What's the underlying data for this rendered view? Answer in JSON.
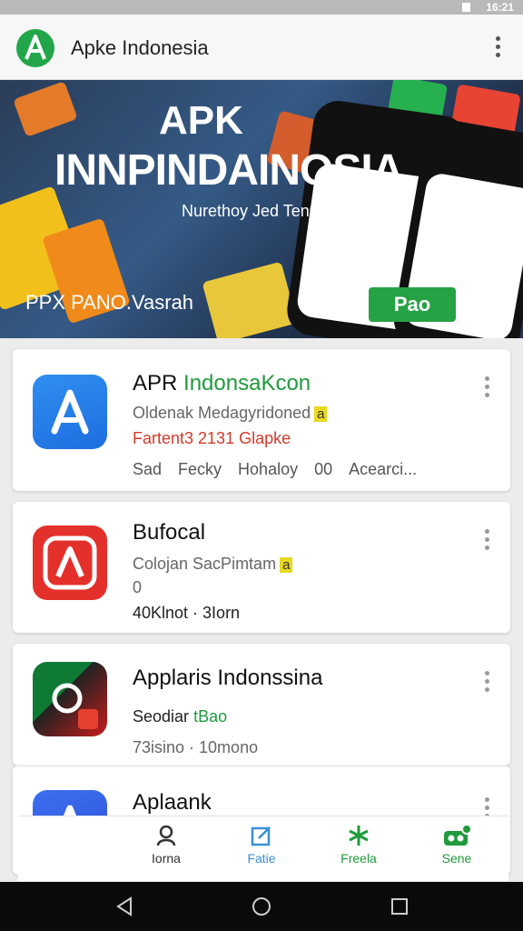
{
  "status": {
    "time": "16:21"
  },
  "app": {
    "title": "Apke Indonesia"
  },
  "hero": {
    "title_line1": "APK",
    "title_line2": "INNPINDAINOSIA",
    "subtitle": "Nurethoy Jed Ten00",
    "tagline": "PPX PANO.Vasrah",
    "badge": "Pao"
  },
  "cards": [
    {
      "title_main": "APR",
      "title_green": "IndonsaKcon",
      "line1": "Oldenak Medagyridoned",
      "line1_badge": "a",
      "line2": "Fartent3 2131 Glapke",
      "stats": [
        "Sad",
        "Fecky",
        "Hohaloy",
        "00",
        "Acearci..."
      ]
    },
    {
      "title_main": "Bufocal",
      "line1": "Colojan SacPimtam",
      "line1_badge": "a",
      "line2": "0",
      "line3": "40Klnot · 3Iorn"
    },
    {
      "title_main": "Applaris Indonssina",
      "line1": "Seodiar",
      "line1_green": "tBao",
      "line2": "73isino · 10mono"
    },
    {
      "title_main": "Aplaank"
    }
  ],
  "nav": [
    {
      "label": "Iorna",
      "icon": "person-icon"
    },
    {
      "label": "Fatie",
      "icon": "edit-icon"
    },
    {
      "label": "Freela",
      "icon": "star-icon"
    },
    {
      "label": "Sene",
      "icon": "gamepad-icon"
    }
  ]
}
